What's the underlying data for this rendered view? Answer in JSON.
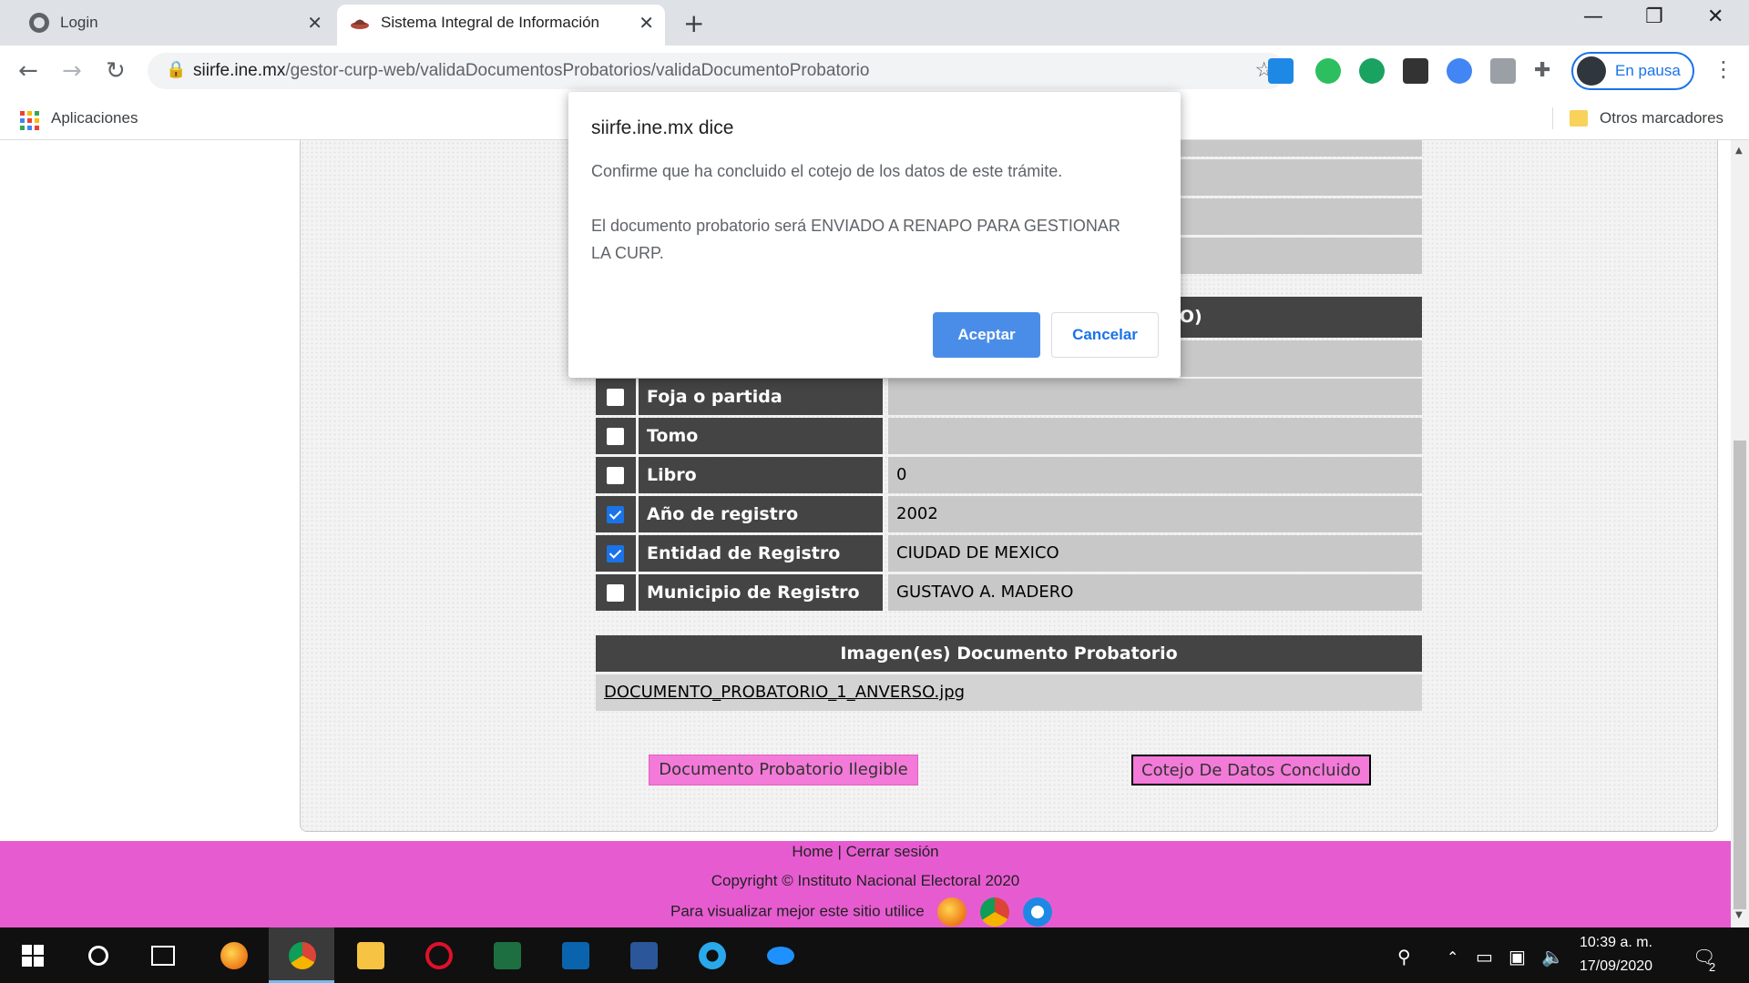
{
  "browser": {
    "tabs": [
      {
        "title": "Login"
      },
      {
        "title": "Sistema Integral de Información"
      }
    ],
    "url_host": "siirfe.ine.mx",
    "url_path": "/gestor-curp-web/validaDocumentosProbatorios/validaDocumentoProbatorio",
    "profile_label": "En pausa",
    "bookmarks": {
      "apps_label": "Aplicaciones",
      "other_label": "Otros marcadores"
    },
    "extensions": [
      "new-extension-icon",
      "evernote-icon",
      "green-d-extension-icon",
      "news-extension-icon",
      "search-extension-icon",
      "translate-extension-icon",
      "puzzle-extensions-icon"
    ]
  },
  "page": {
    "section_header_suffix": "NTO)",
    "fields": [
      {
        "label": "Foja o partida",
        "value": "",
        "checked": false
      },
      {
        "label": "Tomo",
        "value": "",
        "checked": false
      },
      {
        "label": "Libro",
        "value": "0",
        "checked": false
      },
      {
        "label": "Año de registro",
        "value": "2002",
        "checked": true
      },
      {
        "label": "Entidad de Registro",
        "value": "CIUDAD DE MEXICO",
        "checked": true
      },
      {
        "label": "Municipio de Registro",
        "value": "GUSTAVO A. MADERO",
        "checked": false
      }
    ],
    "images_header": "Imagen(es) Documento Probatorio",
    "image_file": "DOCUMENTO_PROBATORIO_1_ANVERSO.jpg",
    "btn_illegible": "Documento Probatorio Ilegible",
    "btn_concluded": "Cotejo De Datos Concluido"
  },
  "footer": {
    "home": "Home",
    "separator": " | ",
    "logout": "Cerrar sesión",
    "copyright": "Copyright ©   Instituto Nacional Electoral 2020",
    "browsers_text": "Para visualizar mejor este sitio utilice"
  },
  "dialog": {
    "title": "siirfe.ine.mx dice",
    "message": "Confirme que ha concluido el cotejo de los datos de este trámite.\n\nEl documento probatorio será ENVIADO A RENAPO PARA GESTIONAR\nLA CURP.",
    "ok_label": "Aceptar",
    "cancel_label": "Cancelar"
  },
  "taskbar": {
    "time": "10:39 a. m.",
    "date": "17/09/2020",
    "notification_count": "2",
    "apps": [
      "firefox-icon",
      "chrome-icon",
      "file-explorer-icon",
      "opera-icon",
      "excel-icon",
      "outlook-icon",
      "word-icon",
      "internet-explorer-icon",
      "app-icon"
    ]
  },
  "colors": {
    "header_dark": "#444444",
    "cell_grey": "#c8c8c8",
    "footer_pink": "#e75bd1",
    "button_pink": "#f37ad8",
    "dialog_accent": "#1a73e8"
  }
}
